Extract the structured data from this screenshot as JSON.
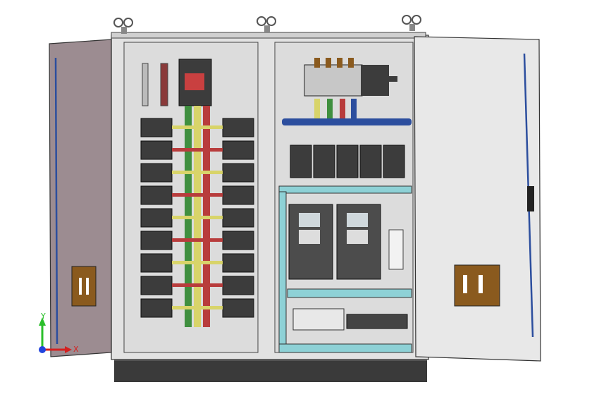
{
  "scene": {
    "subject": "electrical-control-cabinet-3d-model",
    "colors": {
      "background": "#ffffff",
      "cabinet_body": "#e2e2e2",
      "mounting_plate": "#dcdcdc",
      "left_door": "#9c8c91",
      "right_door": "#e8e8e8",
      "plinth": "#3a3a3a",
      "breaker_body": "#3c3c3c",
      "busbar_green": "#3f8f3f",
      "busbar_yellow": "#d8d46a",
      "busbar_red": "#b83c3c",
      "busbar_blue": "#2c4e9e",
      "cable_duct": "#8ed1d6",
      "door_lock": "#8a5a1e",
      "vfd_body": "#4c4c4c"
    },
    "icons": [
      "lifting-eye-icon",
      "door-lock-icon",
      "coordinate-axes-icon"
    ]
  },
  "axes": {
    "x_label": "X",
    "y_label": "Y"
  }
}
